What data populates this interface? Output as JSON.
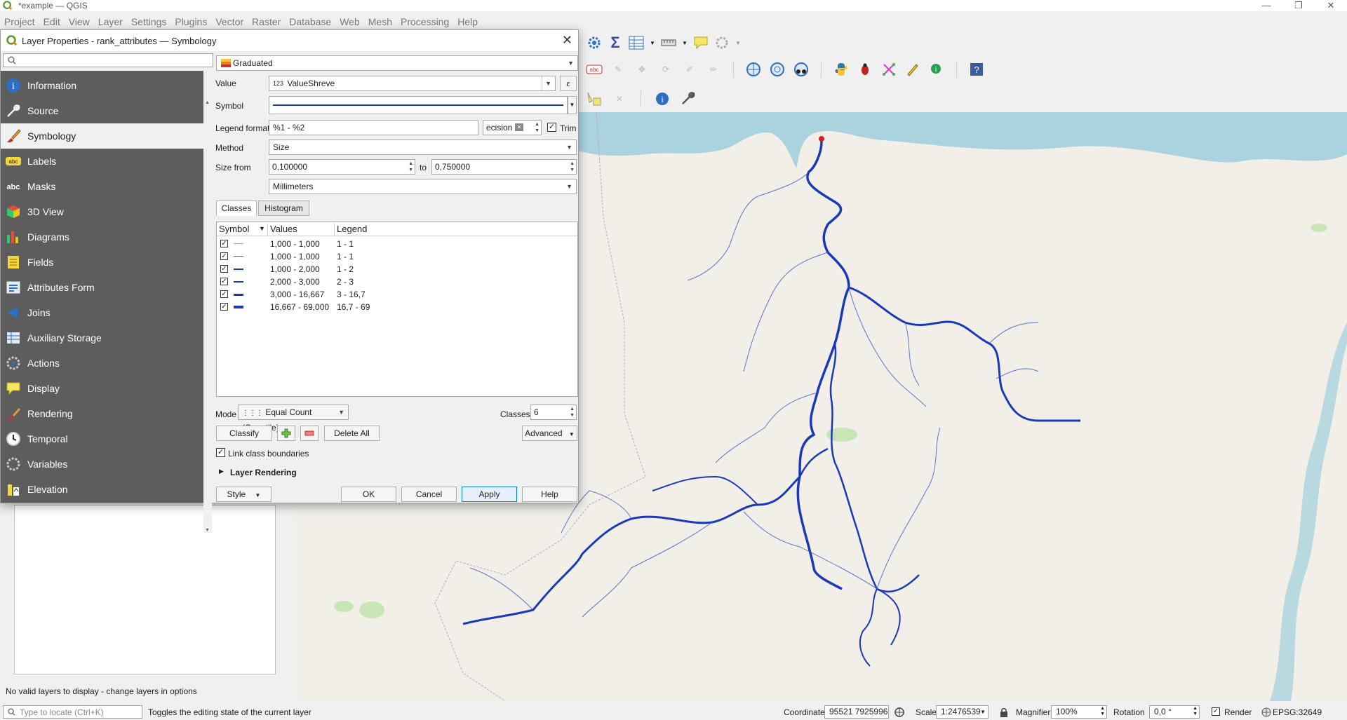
{
  "window": {
    "title": "*example — QGIS",
    "controls": [
      "—",
      "❐",
      "✕"
    ]
  },
  "menubar": [
    "Project",
    "Edit",
    "View",
    "Layer",
    "Settings",
    "Plugins",
    "Vector",
    "Raster",
    "Database",
    "Web",
    "Mesh",
    "Processing",
    "Help"
  ],
  "dialog": {
    "title": "Layer Properties - rank_attributes — Symbology",
    "search_placeholder": "",
    "nav": [
      {
        "label": "Information",
        "icon": "info-icon"
      },
      {
        "label": "Source",
        "icon": "wrench-icon"
      },
      {
        "label": "Symbology",
        "icon": "brush-icon"
      },
      {
        "label": "Labels",
        "icon": "labels-icon"
      },
      {
        "label": "Masks",
        "icon": "masks-icon"
      },
      {
        "label": "3D View",
        "icon": "cube-icon"
      },
      {
        "label": "Diagrams",
        "icon": "diagram-icon"
      },
      {
        "label": "Fields",
        "icon": "fields-icon"
      },
      {
        "label": "Attributes Form",
        "icon": "form-icon"
      },
      {
        "label": "Joins",
        "icon": "joins-icon"
      },
      {
        "label": "Auxiliary Storage",
        "icon": "storage-icon"
      },
      {
        "label": "Actions",
        "icon": "actions-icon"
      },
      {
        "label": "Display",
        "icon": "display-icon"
      },
      {
        "label": "Rendering",
        "icon": "rendering-icon"
      },
      {
        "label": "Temporal",
        "icon": "clock-icon"
      },
      {
        "label": "Variables",
        "icon": "variables-icon"
      },
      {
        "label": "Elevation",
        "icon": "elevation-icon"
      }
    ],
    "renderer": "Graduated",
    "value_label": "Value",
    "value_field": "ValueShreve",
    "value_type_badge": "123",
    "expr_btn": "ε",
    "symbol_label": "Symbol",
    "legend_format_label": "Legend format",
    "legend_format": "%1 - %2",
    "precision_text": "ecision :",
    "trim_label": "Trim",
    "method_label": "Method",
    "method": "Size",
    "size_from_label": "Size from",
    "size_from": "0,100000",
    "to_label": "to",
    "size_to": "0,750000",
    "units": "Millimeters",
    "tabs": [
      "Classes",
      "Histogram"
    ],
    "table_headers": {
      "symbol": "Symbol",
      "values": "Values",
      "legend": "Legend"
    },
    "classes": [
      {
        "values": "1,000 - 1,000",
        "legend": "1 - 1",
        "width": 1
      },
      {
        "values": "1,000 - 1,000",
        "legend": "1 - 1",
        "width": 1.5
      },
      {
        "values": "1,000 - 2,000",
        "legend": "1 - 2",
        "width": 2
      },
      {
        "values": "2,000 - 3,000",
        "legend": "2 - 3",
        "width": 2.5
      },
      {
        "values": "3,000 - 16,667",
        "legend": "3 - 16,7",
        "width": 3
      },
      {
        "values": "16,667 - 69,000",
        "legend": "16,7 - 69",
        "width": 4
      }
    ],
    "mode_label": "Mode",
    "mode": "Equal Count (Quantile)",
    "classes_label": "Classes",
    "classes_count": "6",
    "classify_btn": "Classify",
    "delete_all_btn": "Delete All",
    "advanced_btn": "Advanced",
    "link_boundaries_label": "Link class boundaries",
    "layer_rendering_label": "Layer Rendering",
    "style_btn": "Style",
    "ok_btn": "OK",
    "cancel_btn": "Cancel",
    "apply_btn": "Apply",
    "help_btn": "Help"
  },
  "layers_panel": {
    "message": "No valid layers to display - change layers in options"
  },
  "statusbar": {
    "locator_placeholder": "Type to locate (Ctrl+K)",
    "message": "Toggles the editing state of the current layer",
    "coordinate_label": "Coordinate",
    "coordinate": "95521 7925996",
    "scale_label": "Scale",
    "scale": "1:2476539",
    "magnifier_label": "Magnifier",
    "magnifier": "100%",
    "rotation_label": "Rotation",
    "rotation": "0,0 °",
    "render_label": "Render",
    "crs": "EPSG:32649"
  },
  "colors": {
    "accent": "#0078d7",
    "river": "#1a39b8",
    "map_bg": "#f2efe9",
    "water": "#aad3df",
    "nav_bg": "#5d5d5d"
  }
}
